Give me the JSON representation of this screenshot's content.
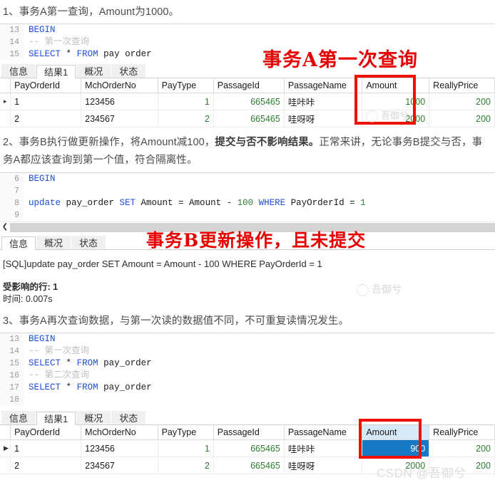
{
  "sections": [
    {
      "id": "s1",
      "paragraph": "1、事务A第一查询，Amount为1000。",
      "editor": {
        "lines": [
          {
            "no": "13",
            "tokens": [
              {
                "t": "BEGIN",
                "c": "kw"
              }
            ]
          },
          {
            "no": "14",
            "tokens": [
              {
                "t": "-- 第一次查询",
                "c": "cmt"
              }
            ]
          },
          {
            "no": "15",
            "tokens": [
              {
                "t": "SELECT",
                "c": "kw"
              },
              {
                "t": " ",
                "c": "plain"
              },
              {
                "t": "*",
                "c": "star"
              },
              {
                "t": " ",
                "c": "plain"
              },
              {
                "t": "FROM",
                "c": "kw"
              },
              {
                "t": " pay order",
                "c": "plain"
              }
            ]
          }
        ]
      },
      "tabs": [
        {
          "label": "信息",
          "active": false
        },
        {
          "label": "结果1",
          "active": true
        },
        {
          "label": "概况",
          "active": false
        },
        {
          "label": "状态",
          "active": false
        }
      ],
      "grid": {
        "columns": [
          "PayOrderId",
          "MchOrderNo",
          "PayType",
          "PassageId",
          "PassageName",
          "Amount",
          "ReallyPrice"
        ],
        "align": [
          "left",
          "left",
          "right",
          "right",
          "left",
          "right",
          "right"
        ],
        "rows": [
          {
            "marker": "▸",
            "cells": [
              "1",
              "123456",
              "1",
              "665465",
              "哇咔咔",
              "1000",
              "200"
            ]
          },
          {
            "marker": "",
            "cells": [
              "2",
              "234567",
              "2",
              "665465",
              "哇呀呀",
              "2000",
              "200"
            ]
          }
        ],
        "selected_column": "Amount",
        "selected_cell": null,
        "column_header_highlight": false
      },
      "annotation": {
        "text": "事务A第一次查询",
        "color": "#e60000"
      }
    },
    {
      "id": "s2",
      "paragraph_parts": [
        {
          "t": "2、事务B执行做更新操作，将Amount减100，",
          "b": false
        },
        {
          "t": "提交与否不影响结果。",
          "b": true
        },
        {
          "t": "正常来讲，无论事务B提交与否，事务A都应该查询到第一个值，符合隔离性。",
          "b": false
        }
      ],
      "editor": {
        "lines": [
          {
            "no": "6",
            "tokens": [
              {
                "t": "BEGIN",
                "c": "kw"
              }
            ]
          },
          {
            "no": "7",
            "tokens": [
              {
                "t": "",
                "c": "plain"
              }
            ]
          },
          {
            "no": "8",
            "tokens": [
              {
                "t": "update",
                "c": "kw"
              },
              {
                "t": " pay_order ",
                "c": "plain"
              },
              {
                "t": "SET",
                "c": "kw"
              },
              {
                "t": " Amount = Amount - ",
                "c": "plain"
              },
              {
                "t": "100",
                "c": "num"
              },
              {
                "t": " ",
                "c": "plain"
              },
              {
                "t": "WHERE",
                "c": "kw"
              },
              {
                "t": " PayOrderId = ",
                "c": "plain"
              },
              {
                "t": "1",
                "c": "num"
              }
            ]
          },
          {
            "no": "9",
            "tokens": [
              {
                "t": "",
                "c": "plain"
              }
            ]
          }
        ]
      },
      "tabs": [
        {
          "label": "信息",
          "active": true
        },
        {
          "label": "概况",
          "active": false
        },
        {
          "label": "状态",
          "active": false
        }
      ],
      "message": {
        "sql": "[SQL]update pay_order SET Amount = Amount - 100 WHERE PayOrderId = 1",
        "affected_rows": "受影响的行: 1",
        "time": "时间: 0.007s"
      },
      "annotation": {
        "text": "事务B更新操作，且未提交",
        "color": "#e60000"
      }
    },
    {
      "id": "s3",
      "paragraph": "3、事务A再次查询数据，与第一次读的数据值不同，不可重复读情况发生。",
      "editor": {
        "lines": [
          {
            "no": "13",
            "tokens": [
              {
                "t": "BEGIN",
                "c": "kw"
              }
            ]
          },
          {
            "no": "14",
            "tokens": [
              {
                "t": "-- 第一次查询",
                "c": "cmt"
              }
            ]
          },
          {
            "no": "15",
            "tokens": [
              {
                "t": "SELECT",
                "c": "kw"
              },
              {
                "t": " ",
                "c": "plain"
              },
              {
                "t": "*",
                "c": "star"
              },
              {
                "t": " ",
                "c": "plain"
              },
              {
                "t": "FROM",
                "c": "kw"
              },
              {
                "t": " pay_order",
                "c": "plain"
              }
            ]
          },
          {
            "no": "16",
            "tokens": [
              {
                "t": "-- 第二次查询",
                "c": "cmt"
              }
            ]
          },
          {
            "no": "17",
            "tokens": [
              {
                "t": "SELECT",
                "c": "kw"
              },
              {
                "t": " ",
                "c": "plain"
              },
              {
                "t": "*",
                "c": "star"
              },
              {
                "t": " ",
                "c": "plain"
              },
              {
                "t": "FROM",
                "c": "kw"
              },
              {
                "t": " pay_order",
                "c": "plain"
              }
            ]
          },
          {
            "no": "18",
            "tokens": [
              {
                "t": "",
                "c": "plain"
              }
            ]
          }
        ]
      },
      "tabs": [
        {
          "label": "信息",
          "active": false
        },
        {
          "label": "结果1",
          "active": true
        },
        {
          "label": "概况",
          "active": false
        },
        {
          "label": "状态",
          "active": false
        }
      ],
      "grid": {
        "columns": [
          "PayOrderId",
          "MchOrderNo",
          "PayType",
          "PassageId",
          "PassageName",
          "Amount",
          "ReallyPrice"
        ],
        "align": [
          "left",
          "left",
          "right",
          "right",
          "left",
          "right",
          "right"
        ],
        "rows": [
          {
            "marker": "▶",
            "cells": [
              "1",
              "123456",
              "1",
              "665465",
              "哇咔咔",
              "900",
              "200"
            ]
          },
          {
            "marker": "",
            "cells": [
              "2",
              "234567",
              "2",
              "665465",
              "哇呀呀",
              "2000",
              "200"
            ]
          }
        ],
        "selected_column": "Amount",
        "selected_cell": "900",
        "column_header_highlight": true
      }
    }
  ],
  "watermarks": {
    "brand": "吾御兮",
    "csdn": "CSDN @吾御兮"
  },
  "colors": {
    "annotation_red": "#e60000",
    "box_red": "#ee1100",
    "selection_blue": "#1878c8",
    "header_highlight": "#d6e9f8"
  }
}
